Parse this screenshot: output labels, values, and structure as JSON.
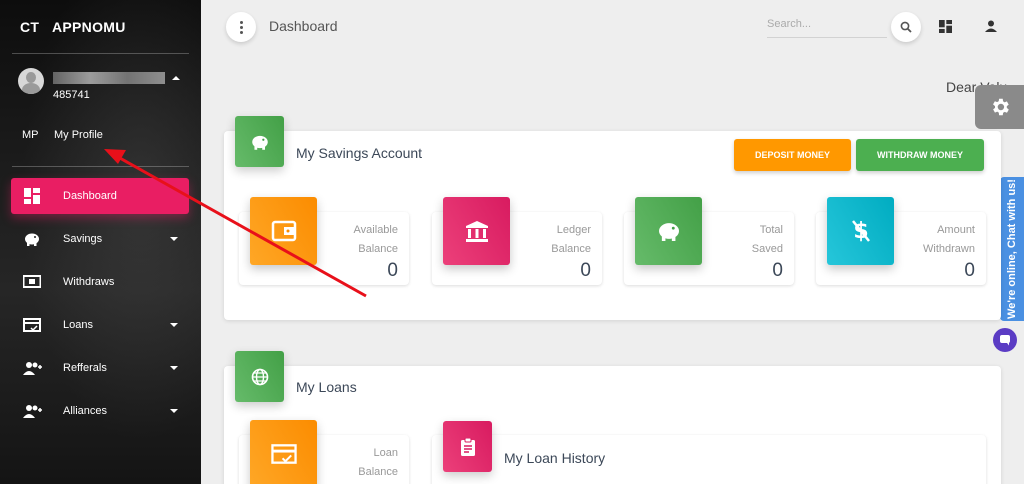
{
  "brand": {
    "mini": "CT",
    "name": "APPNOMU"
  },
  "user": {
    "id": "485741"
  },
  "profile": {
    "mini": "MP",
    "label": "My Profile"
  },
  "nav": [
    {
      "label": "Dashboard",
      "icon": "dashboard-icon",
      "active": true
    },
    {
      "label": "Savings",
      "icon": "piggy-bank-icon"
    },
    {
      "label": "Withdraws",
      "icon": "money-icon"
    },
    {
      "label": "Loans",
      "icon": "credit-card-icon"
    },
    {
      "label": "Refferals",
      "icon": "group-add-icon"
    },
    {
      "label": "Alliances",
      "icon": "group-add-icon"
    }
  ],
  "topbar": {
    "title": "Dashboard",
    "search_placeholder": "Search..."
  },
  "greeting": "Dear Valu",
  "chat": {
    "label": "We're online, Chat with us!"
  },
  "savings": {
    "title": "My Savings Account",
    "deposit_label": "DEPOSIT MONEY",
    "withdraw_label": "WITHDRAW MONEY",
    "stats": [
      {
        "label_line1": "Available",
        "label_line2": "Balance",
        "value": "0",
        "color": "#fb8c00",
        "icon": "wallet-icon"
      },
      {
        "label_line1": "Ledger",
        "label_line2": "Balance",
        "value": "0",
        "color": "#e91e63",
        "icon": "bank-icon"
      },
      {
        "label_line1": "Total",
        "label_line2": "Saved",
        "value": "0",
        "color": "#43a047",
        "icon": "piggy-bank-icon"
      },
      {
        "label_line1": "Amount",
        "label_line2": "Withdrawn",
        "value": "0",
        "color": "#00acc1",
        "icon": "money-off-icon"
      }
    ]
  },
  "loans": {
    "title": "My Loans",
    "loan_label_line1": "Loan",
    "loan_label_line2": "Balance",
    "history_title": "My Loan History"
  },
  "colors": {
    "sidebar_active": "#e91e63",
    "annotation_arrow": "#e8101a"
  }
}
